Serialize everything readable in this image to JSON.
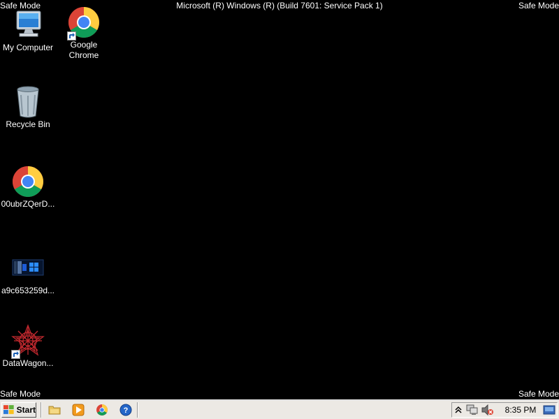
{
  "overlay": {
    "safe_mode_top_left": "Safe Mode",
    "safe_mode_top_right": "Safe Mode",
    "safe_mode_bottom_left": "Safe Mode",
    "safe_mode_bottom_right": "Safe Mode",
    "build_title": "Microsoft (R) Windows (R) (Build 7601: Service Pack 1)"
  },
  "desktop": {
    "icons": [
      {
        "label": "My Computer",
        "icon": "computer-icon"
      },
      {
        "label": "Google Chrome",
        "icon": "chrome-icon",
        "shortcut": true
      },
      {
        "label": "Recycle Bin",
        "icon": "recycle-bin-icon"
      },
      {
        "label": "00ubrZQerD...",
        "icon": "chrome-icon"
      },
      {
        "label": "a9c653259d...",
        "icon": "image-file-icon"
      },
      {
        "label": "DataWagon...",
        "icon": "spiral-icon",
        "shortcut": true
      }
    ]
  },
  "taskbar": {
    "start_label": "Start",
    "quick_launch": [
      {
        "icon": "explorer-folder-icon"
      },
      {
        "icon": "media-player-icon"
      },
      {
        "icon": "chrome-icon"
      },
      {
        "icon": "help-icon"
      }
    ],
    "tray": {
      "icons": [
        "show-hidden-icons-chevron",
        "network-icon",
        "volume-muted-icon"
      ],
      "clock": "8:35 PM",
      "show_desktop_icon": "show-desktop-icon"
    }
  },
  "colors": {
    "desktop_bg": "#000000",
    "taskbar_bg": "#ece9e4",
    "text_light": "#ffffff"
  }
}
